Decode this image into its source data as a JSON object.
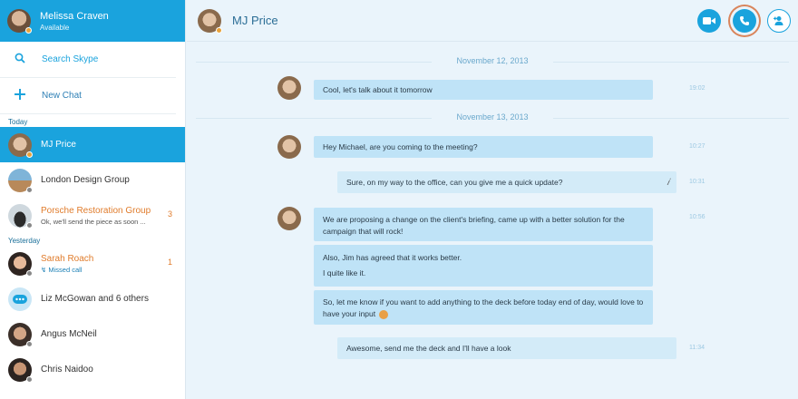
{
  "profile": {
    "name": "Melissa Craven",
    "status": "Available"
  },
  "actions": {
    "search": "Search Skype",
    "new_chat": "New Chat"
  },
  "sections": {
    "today": "Today",
    "yesterday": "Yesterday"
  },
  "contacts": [
    {
      "name": "MJ Price",
      "sub": "",
      "count": ""
    },
    {
      "name": "London Design Group",
      "sub": "",
      "count": ""
    },
    {
      "name": "Porsche Restoration Group",
      "sub": "Ok, we'll send the piece as soon ...",
      "count": "3"
    },
    {
      "name": "Sarah Roach",
      "sub": "Missed call",
      "count": "1"
    },
    {
      "name": "Liz McGowan and 6 others",
      "sub": "",
      "count": ""
    },
    {
      "name": "Angus McNeil",
      "sub": "",
      "count": ""
    },
    {
      "name": "Chris Naidoo",
      "sub": "",
      "count": ""
    }
  ],
  "header": {
    "title": "MJ Price"
  },
  "dates": [
    "November 12, 2013",
    "November 13, 2013"
  ],
  "messages": [
    {
      "text": "Cool, let's talk about it tomorrow",
      "time": "19:02"
    },
    {
      "text": "Hey Michael, are you coming to the meeting?",
      "time": "10:27"
    },
    {
      "text": "Sure, on my way to the office, can you give me a quick update?",
      "time": "10:31"
    },
    {
      "text": "We are proposing a change on the client's briefing, came up with a better solution for the campaign that will rock!",
      "time": "10:56"
    },
    {
      "line1": "Also, Jim has agreed that it works better.",
      "line2": "I quite like it."
    },
    {
      "text": "So, let me know if you want to add anything to the deck before today end of day, would love to have your input"
    },
    {
      "text": "Awesome, send me the deck and I'll have a look",
      "time": "11:34"
    }
  ],
  "colors": {
    "accent": "#1aa3dd",
    "unread": "#e07c2c",
    "bubble_in": "#bfe3f7",
    "bubble_out": "#d3ebf8"
  }
}
